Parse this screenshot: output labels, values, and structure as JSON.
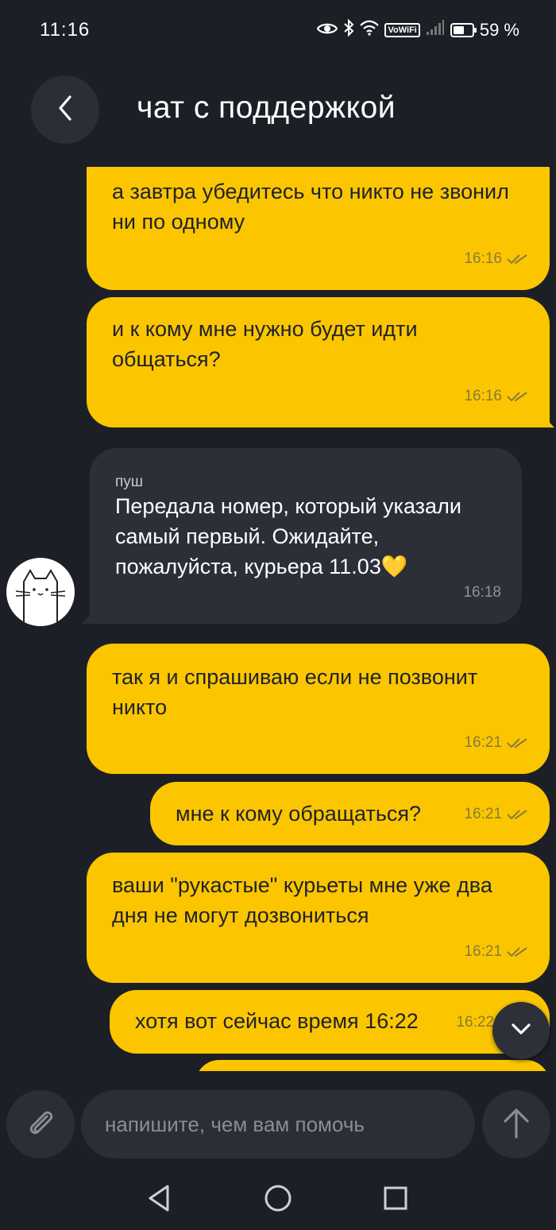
{
  "status_bar": {
    "time": "11:16",
    "vowifi": "VoWiFi",
    "battery": "59 %",
    "battery_level": 0.59
  },
  "header": {
    "title": "чат с поддержкой"
  },
  "messages": [
    {
      "direction": "out",
      "text": "а завтра убедитесь что никто не звонил ни по одному",
      "time": "16:16"
    },
    {
      "direction": "out",
      "text": "и к кому мне нужно будет идти общаться?",
      "time": "16:16"
    },
    {
      "direction": "in",
      "sender": "пуш",
      "text": "Передала номер, который указали самый первый. Ожидайте, пожалуйста, курьера 11.03💛",
      "time": "16:18"
    },
    {
      "direction": "out",
      "text": "так я и спрашиваю если не позвонит никто",
      "time": "16:21"
    },
    {
      "direction": "out",
      "text": "мне к кому обращаться?",
      "time": "16:21"
    },
    {
      "direction": "out",
      "text": "ваши \"рукастые\" курьеты мне уже два дня не могут дозвониться",
      "time": "16:21"
    },
    {
      "direction": "out",
      "text": "хотя вот сейчас время 16:22",
      "time": "16:22"
    }
  ],
  "composer": {
    "placeholder": "напишите, чем вам помочь"
  },
  "colors": {
    "background": "#1d1f27",
    "outgoing_bubble": "#fbc600",
    "incoming_bubble": "#2c2e38",
    "control_bg": "#2b2d37"
  }
}
